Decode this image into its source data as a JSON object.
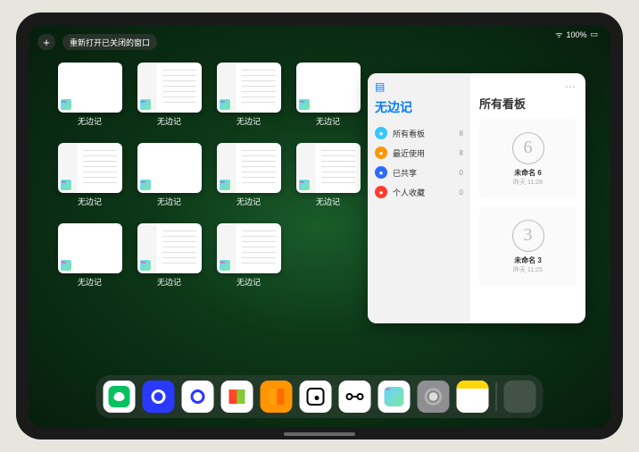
{
  "status": {
    "wifi": "􀙇",
    "battery": "100%"
  },
  "buttons": {
    "plus": "+",
    "reopen": "重新打开已关闭的窗口"
  },
  "apps": [
    {
      "label": "无边记",
      "thumb": "blank"
    },
    {
      "label": "无边记",
      "thumb": "list"
    },
    {
      "label": "无边记",
      "thumb": "list"
    },
    {
      "label": "无边记",
      "thumb": "blank"
    },
    {
      "label": "无边记",
      "thumb": "list"
    },
    {
      "label": "无边记",
      "thumb": "blank"
    },
    {
      "label": "无边记",
      "thumb": "list"
    },
    {
      "label": "无边记",
      "thumb": "list"
    },
    {
      "label": "无边记",
      "thumb": "blank"
    },
    {
      "label": "无边记",
      "thumb": "list"
    },
    {
      "label": "无边记",
      "thumb": "list"
    }
  ],
  "panel": {
    "left_title": "无边记",
    "right_title": "所有看板",
    "sidebar": [
      {
        "icon_color": "#34c8ff",
        "label": "所有看板",
        "count": "8"
      },
      {
        "icon_color": "#ff9500",
        "label": "最近使用",
        "count": "8"
      },
      {
        "icon_color": "#2b6cff",
        "label": "已共享",
        "count": "0"
      },
      {
        "icon_color": "#ff3b30",
        "label": "个人收藏",
        "count": "0"
      }
    ],
    "boards": [
      {
        "sketch": "6",
        "name": "未命名 6",
        "date": "昨天 11:28"
      },
      {
        "sketch": "3",
        "name": "未命名 3",
        "date": "昨天 11:25"
      }
    ]
  },
  "dock": [
    {
      "name": "wechat",
      "bg": "#fff",
      "glyph_bg": "#07c160"
    },
    {
      "name": "quark-blue",
      "bg": "#2a39ff"
    },
    {
      "name": "quark-white",
      "bg": "#fff",
      "ring": "#2a39ff"
    },
    {
      "name": "play",
      "bg": "#fff"
    },
    {
      "name": "books",
      "bg": "#ff9500"
    },
    {
      "name": "dice",
      "bg": "#fff"
    },
    {
      "name": "bowtie",
      "bg": "#fff"
    },
    {
      "name": "freeform",
      "bg": "#fff"
    },
    {
      "name": "settings",
      "bg": "#8e8e93"
    },
    {
      "name": "notes",
      "bg": "#fff"
    }
  ]
}
